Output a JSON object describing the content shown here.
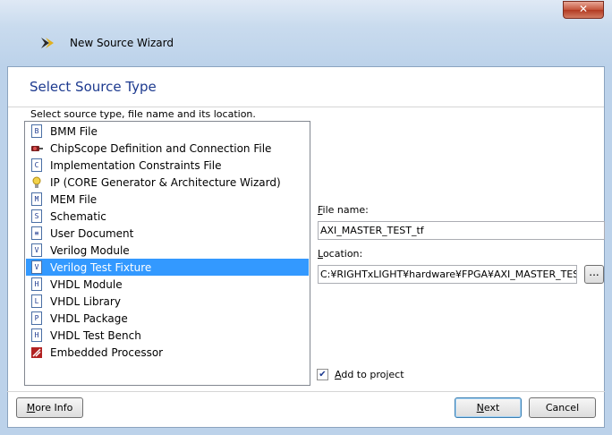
{
  "window": {
    "title": "New Source Wizard",
    "close_glyph": "✕"
  },
  "header": {
    "title": "Select Source Type",
    "instruction": "Select source type, file name and its location."
  },
  "source_types": [
    {
      "label": "BMM File",
      "icon": "bmm-file-icon"
    },
    {
      "label": "ChipScope Definition and Connection File",
      "icon": "chipscope-icon"
    },
    {
      "label": "Implementation Constraints File",
      "icon": "constraints-file-icon"
    },
    {
      "label": "IP (CORE Generator & Architecture Wizard)",
      "icon": "ip-core-icon"
    },
    {
      "label": "MEM File",
      "icon": "mem-file-icon"
    },
    {
      "label": "Schematic",
      "icon": "schematic-icon"
    },
    {
      "label": "User Document",
      "icon": "user-document-icon"
    },
    {
      "label": "Verilog Module",
      "icon": "verilog-module-icon"
    },
    {
      "label": "Verilog Test Fixture",
      "icon": "verilog-test-fixture-icon",
      "selected": true
    },
    {
      "label": "VHDL Module",
      "icon": "vhdl-module-icon"
    },
    {
      "label": "VHDL Library",
      "icon": "vhdl-library-icon"
    },
    {
      "label": "VHDL Package",
      "icon": "vhdl-package-icon"
    },
    {
      "label": "VHDL Test Bench",
      "icon": "vhdl-test-bench-icon"
    },
    {
      "label": "Embedded Processor",
      "icon": "embedded-processor-icon"
    }
  ],
  "file_name": {
    "label_prefix": "",
    "label_accel": "F",
    "label_rest": "ile name:",
    "value": "AXI_MASTER_TEST_tf"
  },
  "location": {
    "label_prefix": "",
    "label_accel": "L",
    "label_rest": "ocation:",
    "value": "C:¥RIGHTxLIGHT¥hardware¥FPGA¥AXI_MASTER_TEST",
    "browse_label": "..."
  },
  "add_to_project": {
    "label_accel": "A",
    "label_rest": "dd to project",
    "checked": true,
    "check_glyph": "✔"
  },
  "buttons": {
    "more_info_accel": "M",
    "more_info_rest": "ore Info",
    "next_accel": "N",
    "next_rest": "ext",
    "cancel": "Cancel"
  },
  "colors": {
    "selection": "#3399ff",
    "header_title": "#1d3a8f"
  }
}
